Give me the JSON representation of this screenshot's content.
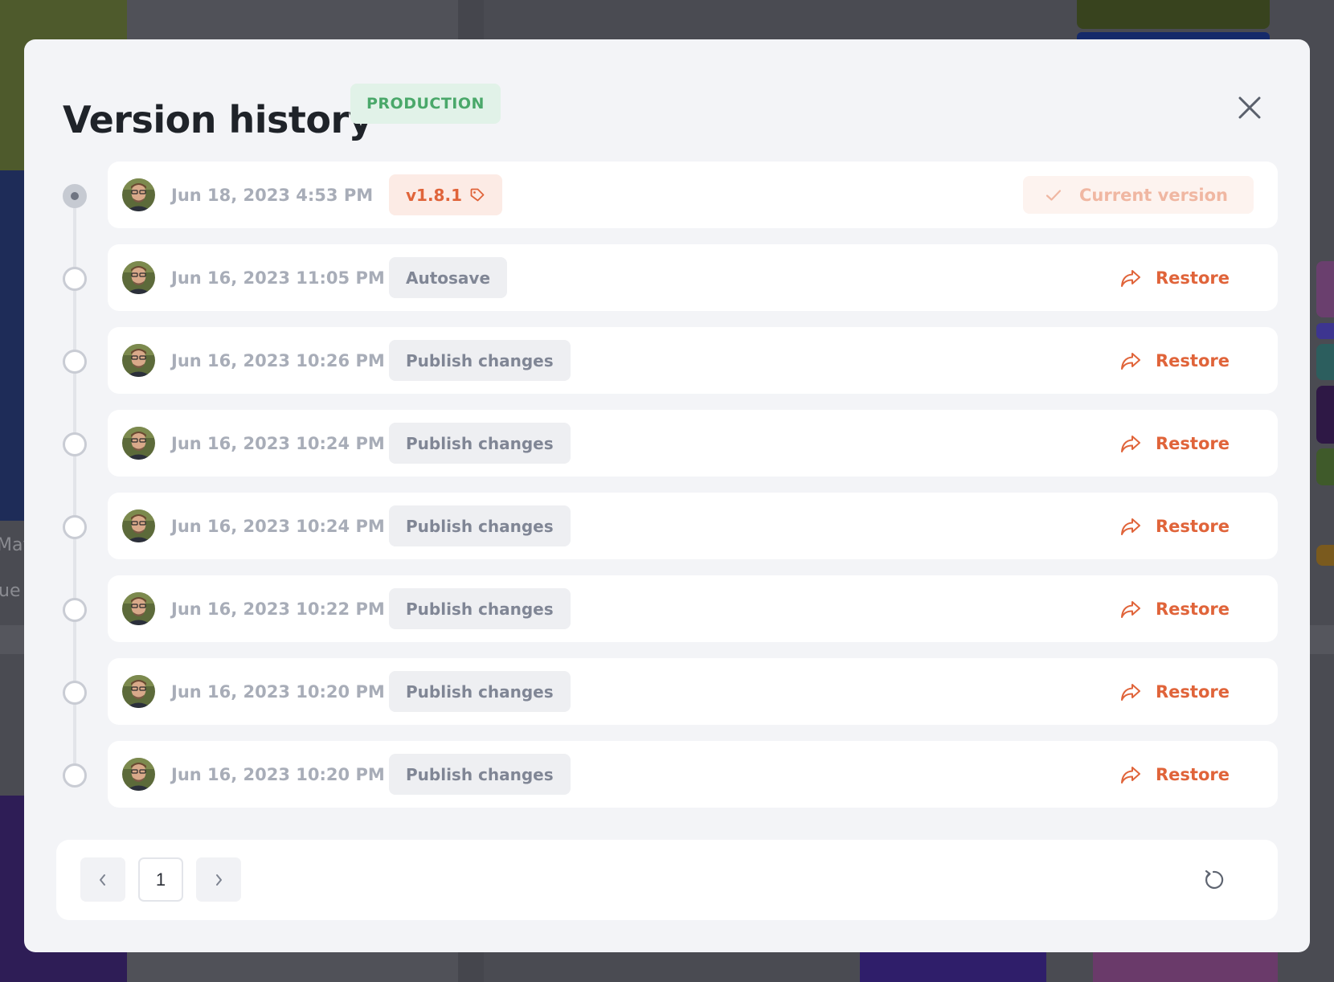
{
  "background": {
    "partial_text_1": "May",
    "partial_text_2": "ue"
  },
  "modal": {
    "title": "Version history",
    "environment_badge": "PRODUCTION",
    "close_icon": "close-icon"
  },
  "versions": [
    {
      "date": "Jun 18, 2023 4:53 PM",
      "tag": "v1.8.1",
      "tag_icon": "tag-icon",
      "status": "Current version",
      "is_current": true
    },
    {
      "date": "Jun 16, 2023 11:05 PM",
      "tag": "Autosave",
      "action": "Restore",
      "is_current": false
    },
    {
      "date": "Jun 16, 2023 10:26 PM",
      "tag": "Publish changes",
      "action": "Restore",
      "is_current": false
    },
    {
      "date": "Jun 16, 2023 10:24 PM",
      "tag": "Publish changes",
      "action": "Restore",
      "is_current": false
    },
    {
      "date": "Jun 16, 2023 10:24 PM",
      "tag": "Publish changes",
      "action": "Restore",
      "is_current": false
    },
    {
      "date": "Jun 16, 2023 10:22 PM",
      "tag": "Publish changes",
      "action": "Restore",
      "is_current": false
    },
    {
      "date": "Jun 16, 2023 10:20 PM",
      "tag": "Publish changes",
      "action": "Restore",
      "is_current": false
    },
    {
      "date": "Jun 16, 2023 10:20 PM",
      "tag": "Publish changes",
      "action": "Restore",
      "is_current": false
    }
  ],
  "pagination": {
    "current_page": "1",
    "prev_icon": "chevron-left-icon",
    "next_icon": "chevron-right-icon",
    "refresh_icon": "refresh-icon"
  },
  "colors": {
    "accent": "#e0643a",
    "badge_green": "#4aa86a",
    "overlay": "#4a4b52"
  }
}
